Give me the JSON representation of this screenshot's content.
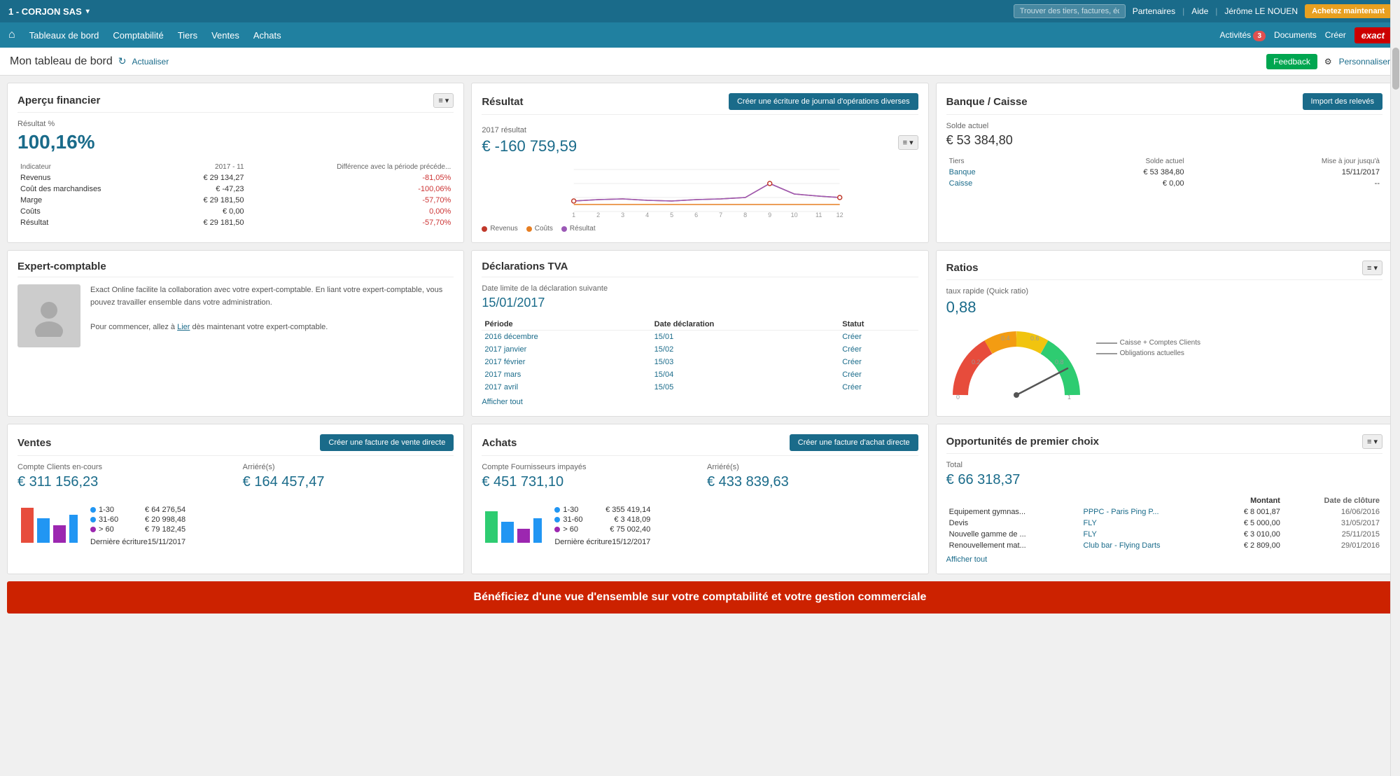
{
  "app": {
    "company": "1 - CORJON SAS",
    "nav_links": [
      "Tableaux de bord",
      "Comptabilité",
      "Tiers",
      "Ventes",
      "Achats"
    ],
    "search_placeholder": "Trouver des tiers, factures, écr...",
    "partenaires": "Partenaires",
    "aide": "Aide",
    "user": "Jérôme LE NOUEN",
    "acheter_btn": "Achetez maintenant",
    "activites": "Activités",
    "activites_count": "3",
    "documents": "Documents",
    "creer": "Créer",
    "exact": "exact"
  },
  "page": {
    "title": "Mon tableau de bord",
    "refresh": "Actualiser",
    "feedback": "Feedback",
    "personaliser": "Personnaliser"
  },
  "apercu_financier": {
    "title": "Aperçu financier",
    "result_percent_label": "Résultat %",
    "result_percent_value": "100,16%",
    "indicator_header_col2": "2017 - 11",
    "indicator_header_col3": "Différence avec la période précéde...",
    "rows": [
      {
        "label": "Revenus",
        "val": "€ 29 134,27",
        "diff": "-81,05%"
      },
      {
        "label": "Coût des marchandises",
        "val": "€ -47,23",
        "diff": "-100,06%"
      },
      {
        "label": "Marge",
        "val": "€ 29 181,50",
        "diff": "-57,70%"
      },
      {
        "label": "Coûts",
        "val": "€ 0,00",
        "diff": "0,00%"
      },
      {
        "label": "Résultat",
        "val": "€ 29 181,50",
        "diff": "-57,70%"
      }
    ]
  },
  "resultat": {
    "title": "Résultat",
    "create_btn": "Créer une écriture de journal d'opérations diverses",
    "year_label": "2017 résultat",
    "year_value": "€ -160 759,59",
    "legend": [
      "Revenus",
      "Coûts",
      "Résultat"
    ],
    "x_labels": [
      "1",
      "2",
      "3",
      "4",
      "5",
      "6",
      "7",
      "8",
      "9",
      "10",
      "11",
      "12"
    ]
  },
  "banque_caisse": {
    "title": "Banque / Caisse",
    "import_btn": "Import des relevés",
    "solde_label": "Solde actuel",
    "solde_value": "€ 53 384,80",
    "col_solde": "Solde actuel",
    "col_maj": "Mise à jour jusqu'à",
    "rows": [
      {
        "tiers": "Banque",
        "solde": "€ 53 384,80",
        "maj": "15/11/2017"
      },
      {
        "tiers": "Caisse",
        "solde": "€ 0,00",
        "maj": "--"
      }
    ]
  },
  "expert_comptable": {
    "title": "Expert-comptable",
    "text1": "Exact Online facilite la collaboration avec votre expert-comptable. En liant votre expert-comptable, vous pouvez travailler ensemble dans votre administration.",
    "text2": "Pour commencer, allez à Lier dès maintenant votre expert-comptable."
  },
  "declarations_tva": {
    "title": "Déclarations TVA",
    "date_label": "Date limite de la déclaration suivante",
    "date_value": "15/01/2017",
    "col_periode": "Période",
    "col_date": "Date déclaration",
    "col_statut": "Statut",
    "rows": [
      {
        "periode": "2016 décembre",
        "date": "15/01",
        "statut": "Créer"
      },
      {
        "periode": "2017 janvier",
        "date": "15/02",
        "statut": "Créer"
      },
      {
        "periode": "2017 février",
        "date": "15/03",
        "statut": "Créer"
      },
      {
        "periode": "2017 mars",
        "date": "15/04",
        "statut": "Créer"
      },
      {
        "periode": "2017 avril",
        "date": "15/05",
        "statut": "Créer"
      }
    ],
    "afficher_tout": "Afficher tout"
  },
  "ratios": {
    "title": "Ratios",
    "ratio_label": "taux rapide (Quick ratio)",
    "ratio_value": "0,88",
    "legend": [
      {
        "label": "Caisse + Comptes Clients"
      },
      {
        "label": "Obligations actuelles"
      }
    ],
    "gauge_values": [
      0,
      0.2,
      0.4,
      0.6,
      0.8,
      1
    ],
    "gauge_pointer": 0.88
  },
  "ventes": {
    "title": "Ventes",
    "create_btn": "Créer une facture de vente directe",
    "compte_label": "Compte Clients en-cours",
    "compte_value": "€ 311 156,23",
    "arriere_label": "Arriéré(s)",
    "arriere_value": "€ 164 457,47",
    "legend": [
      {
        "label": "1-30",
        "value": "€ 64 276,54",
        "color": "#2196F3"
      },
      {
        "label": "31-60",
        "value": "€ 20 998,48",
        "color": "#2196F3"
      },
      {
        "label": "> 60",
        "value": "€ 79 182,45",
        "color": "#9C27B0"
      }
    ],
    "derniere_ecriture": "Dernière écriture",
    "derniere_ecriture_date": "15/11/2017"
  },
  "achats": {
    "title": "Achats",
    "create_btn": "Créer une facture d'achat directe",
    "compte_label": "Compte Fournisseurs impayés",
    "compte_value": "€ 451 731,10",
    "arriere_label": "Arriéré(s)",
    "arriere_value": "€ 433 839,63",
    "legend": [
      {
        "label": "1-30",
        "value": "€ 355 419,14",
        "color": "#2196F3"
      },
      {
        "label": "31-60",
        "value": "€ 3 418,09",
        "color": "#2196F3"
      },
      {
        "label": "> 60",
        "value": "€ 75 002,40",
        "color": "#9C27B0"
      }
    ],
    "derniere_ecriture": "Dernière écriture",
    "derniere_ecriture_date": "15/12/2017"
  },
  "opportunites": {
    "title": "Opportunités de premier choix",
    "total_label": "Total",
    "total_value": "€ 66 318,37",
    "col_montant": "Montant",
    "col_cloture": "Date de clôture",
    "rows": [
      {
        "desc": "Equipement gymnas...",
        "partner": "PPPC - Paris Ping P...",
        "montant": "€ 8 001,87",
        "cloture": "16/06/2016"
      },
      {
        "desc": "Devis",
        "partner": "FLY",
        "montant": "€ 5 000,00",
        "cloture": "31/05/2017"
      },
      {
        "desc": "Nouvelle gamme de ...",
        "partner": "FLY",
        "montant": "€ 3 010,00",
        "cloture": "25/11/2015"
      },
      {
        "desc": "Renouvellement mat...",
        "partner": "Club bar - Flying Darts",
        "montant": "€ 2 809,00",
        "cloture": "29/01/2016"
      }
    ],
    "afficher_tout": "Afficher tout"
  },
  "banner": {
    "text": "Bénéficiez d'une vue d'ensemble sur votre comptabilité et votre gestion commerciale"
  }
}
